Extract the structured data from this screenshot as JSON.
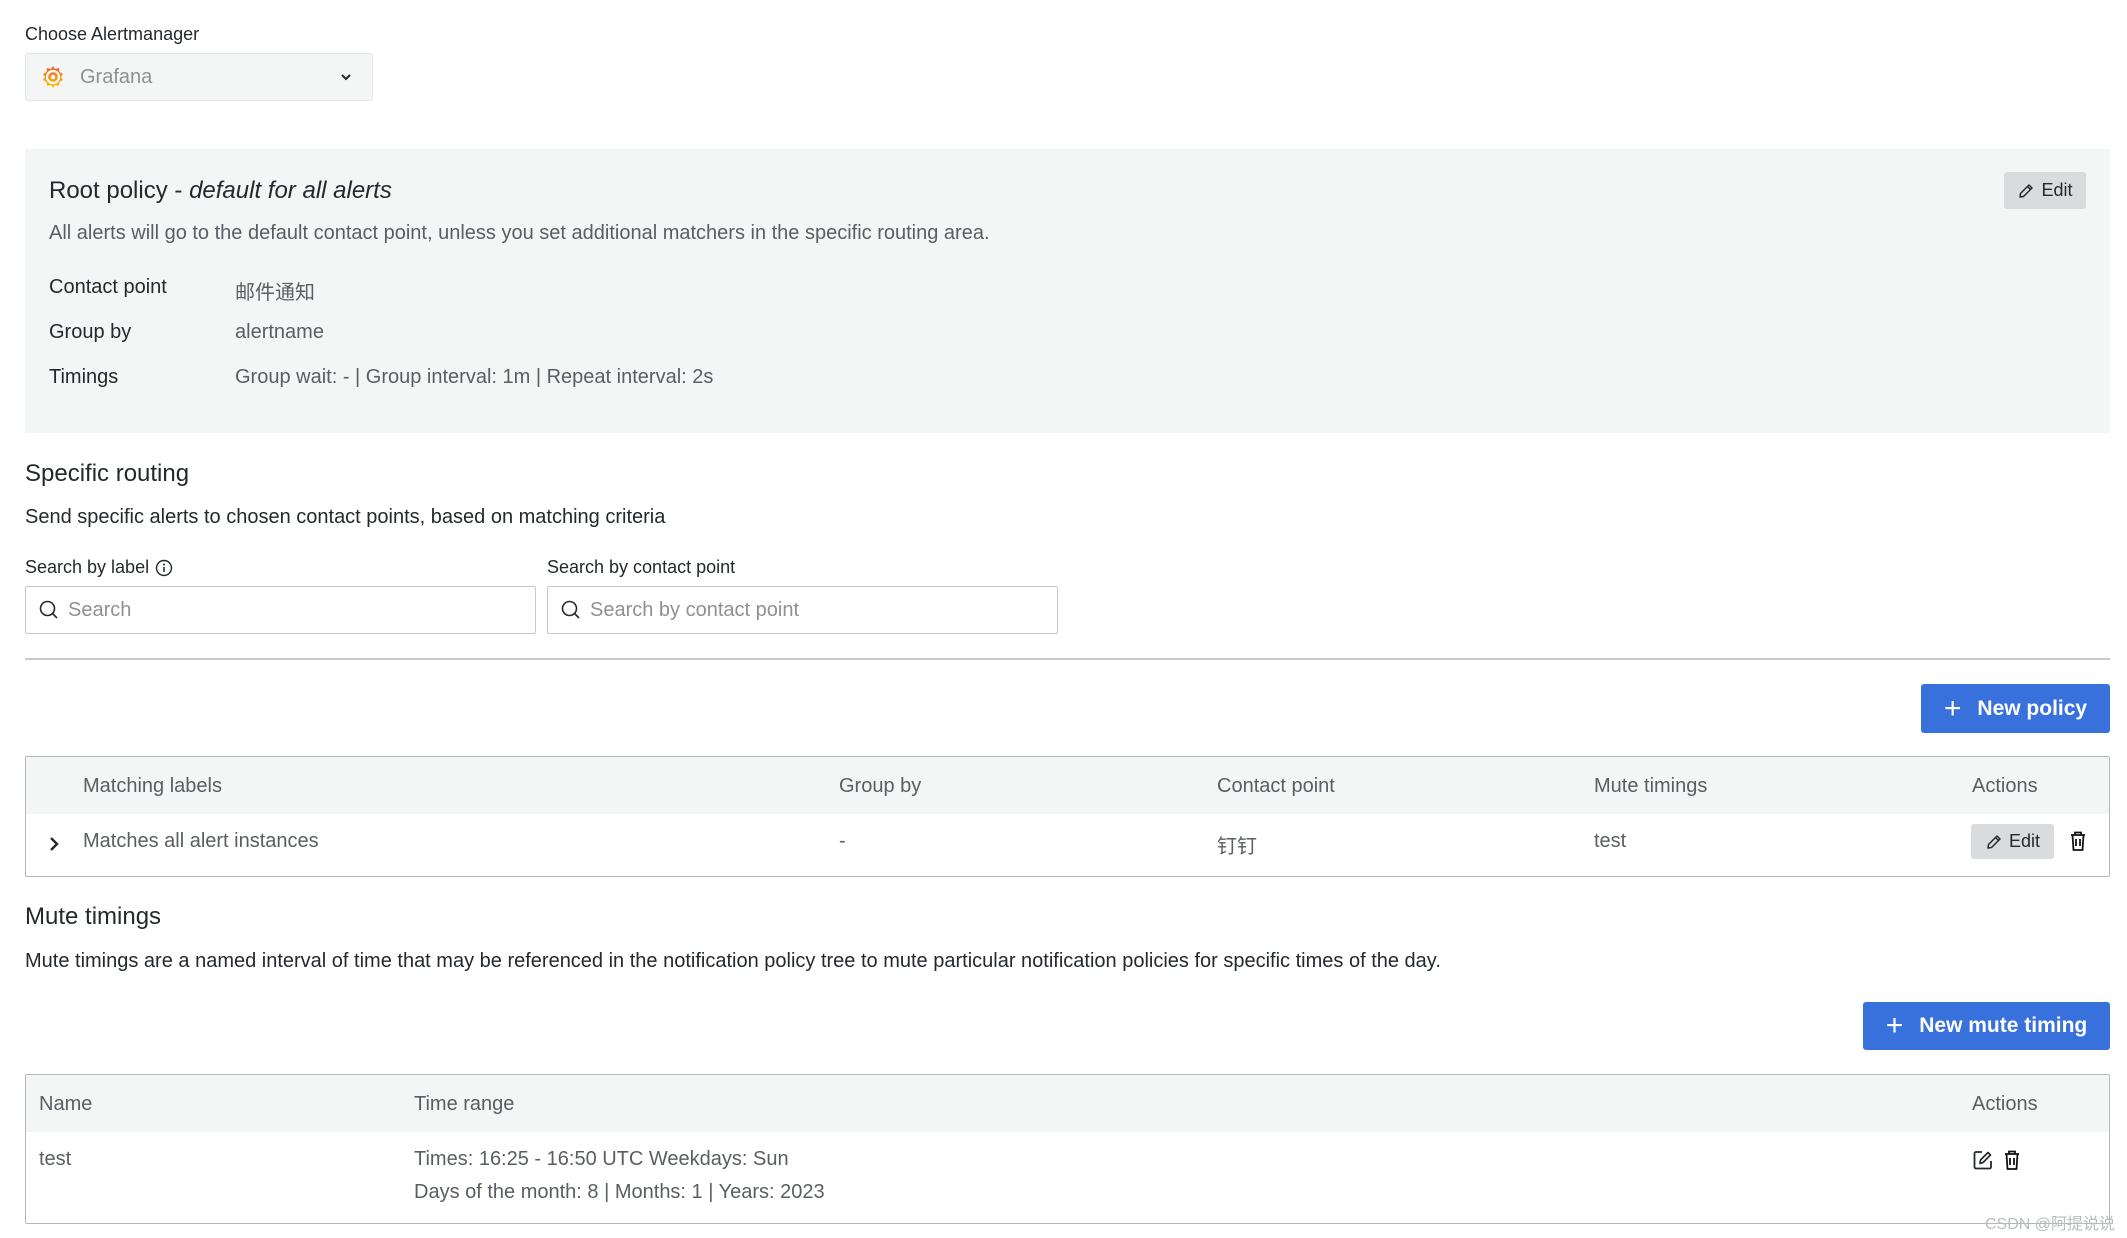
{
  "alertmanager": {
    "label": "Choose Alertmanager",
    "selected": "Grafana",
    "logo_icon": "grafana-logo-icon"
  },
  "root_policy": {
    "title": "Root policy - ",
    "title_em": "default for all alerts",
    "description": "All alerts will go to the default contact point, unless you set additional matchers in the specific routing area.",
    "edit_label": "Edit",
    "rows": [
      {
        "key": "Contact point",
        "value": "邮件通知"
      },
      {
        "key": "Group by",
        "value": "alertname"
      },
      {
        "key": "Timings",
        "value": "Group wait: - | Group interval: 1m | Repeat interval: 2s"
      }
    ]
  },
  "specific_routing": {
    "title": "Specific routing",
    "description": "Send specific alerts to chosen contact points, based on matching criteria",
    "search_label": {
      "label": "Search by label",
      "placeholder": "Search",
      "value": ""
    },
    "search_contact": {
      "label": "Search by contact point",
      "placeholder": "Search by contact point",
      "value": ""
    },
    "new_policy_label": "New policy",
    "table": {
      "headers": [
        "Matching labels",
        "Group by",
        "Contact point",
        "Mute timings",
        "Actions"
      ],
      "rows": [
        {
          "matching_labels": "Matches all alert instances",
          "group_by": "-",
          "contact_point": "钉钉",
          "mute_timings": "test",
          "edit_label": "Edit"
        }
      ]
    }
  },
  "mute_timings": {
    "title": "Mute timings",
    "description": "Mute timings are a named interval of time that may be referenced in the notification policy tree to mute particular notification policies for specific times of the day.",
    "new_label": "New mute timing",
    "table": {
      "headers": [
        "Name",
        "Time range",
        "Actions"
      ],
      "rows": [
        {
          "name": "test",
          "time_range_line1": "Times: 16:25 - 16:50 UTC Weekdays: Sun",
          "time_range_line2": "Days of the month: 8 | Months: 1 | Years: 2023"
        }
      ]
    }
  },
  "watermark": "CSDN @阿提说说",
  "colors": {
    "primary": "#3871dc",
    "panel_bg": "#f4f5f5",
    "secondary_btn": "#d9dbdc"
  }
}
